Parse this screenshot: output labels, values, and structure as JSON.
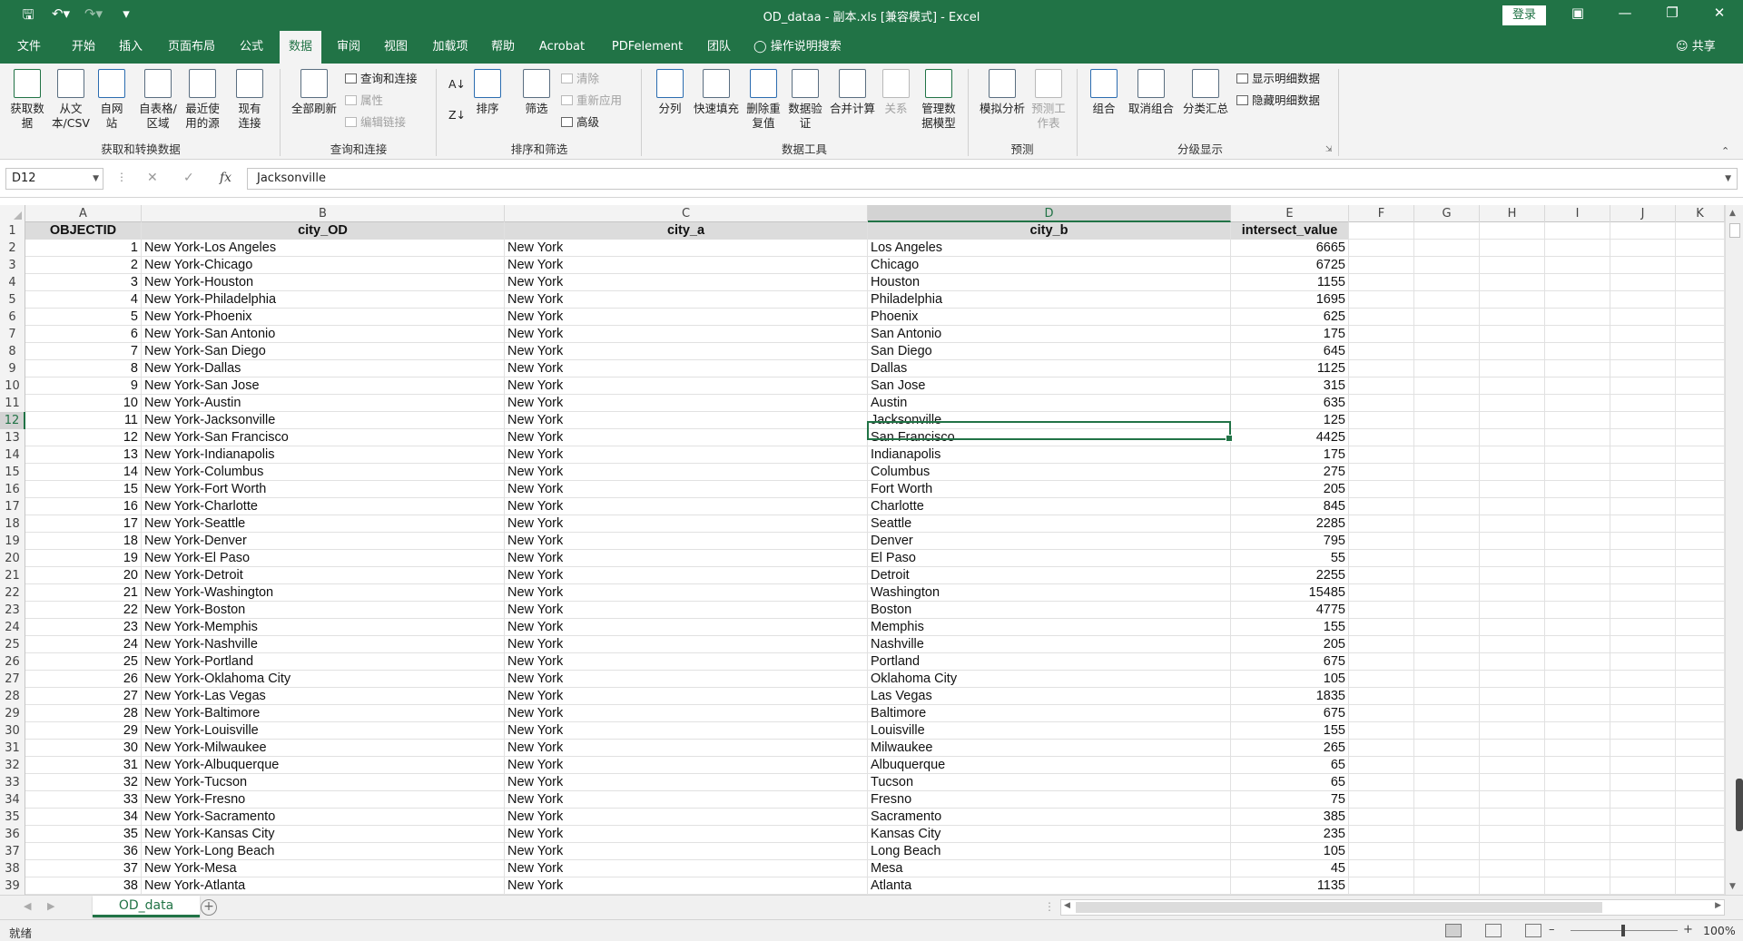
{
  "app": {
    "title": "OD_dataa - 副本.xls  [兼容模式]  -  Excel",
    "login_label": "登录",
    "share_label": "共享",
    "tell_me": "操作说明搜索"
  },
  "menu_tabs": [
    "文件",
    "开始",
    "插入",
    "页面布局",
    "公式",
    "数据",
    "审阅",
    "视图",
    "加载项",
    "帮助",
    "Acrobat",
    "PDFelement",
    "团队"
  ],
  "ribbon": {
    "get_transform": {
      "label": "获取和转换数据",
      "buttons": [
        "获取数据",
        "从文本/CSV",
        "自网站",
        "自表格/区域",
        "最近使用的源",
        "现有连接"
      ]
    },
    "queries": {
      "label": "查询和连接",
      "refresh_all": "全部刷新",
      "items": [
        "查询和连接",
        "属性",
        "编辑链接"
      ]
    },
    "sort_filter": {
      "label": "排序和筛选",
      "sort": "排序",
      "filter": "筛选",
      "items": [
        "清除",
        "重新应用",
        "高级"
      ]
    },
    "data_tools": {
      "label": "数据工具",
      "buttons": [
        "分列",
        "快速填充",
        "删除重复值",
        "数据验证",
        "合并计算",
        "关系",
        "管理数据模型"
      ]
    },
    "forecast": {
      "label": "预测",
      "buttons": [
        "模拟分析",
        "预测工作表"
      ]
    },
    "outline": {
      "label": "分级显示",
      "buttons": [
        "组合",
        "取消组合",
        "分类汇总"
      ],
      "items": [
        "显示明细数据",
        "隐藏明细数据"
      ]
    }
  },
  "formula_bar": {
    "name_box": "D12",
    "content": "Jacksonville"
  },
  "columns": [
    "A",
    "B",
    "C",
    "D",
    "E",
    "F",
    "G",
    "H",
    "I",
    "J",
    "K"
  ],
  "headers": [
    "OBJECTID",
    "city_OD",
    "city_a",
    "city_b",
    "intersect_value"
  ],
  "rows": [
    [
      "1",
      "New York-Los Angeles",
      "New York",
      "Los Angeles",
      "6665"
    ],
    [
      "2",
      "New York-Chicago",
      "New York",
      "Chicago",
      "6725"
    ],
    [
      "3",
      "New York-Houston",
      "New York",
      "Houston",
      "1155"
    ],
    [
      "4",
      "New York-Philadelphia",
      "New York",
      "Philadelphia",
      "1695"
    ],
    [
      "5",
      "New York-Phoenix",
      "New York",
      "Phoenix",
      "625"
    ],
    [
      "6",
      "New York-San Antonio",
      "New York",
      "San Antonio",
      "175"
    ],
    [
      "7",
      "New York-San Diego",
      "New York",
      "San Diego",
      "645"
    ],
    [
      "8",
      "New York-Dallas",
      "New York",
      "Dallas",
      "1125"
    ],
    [
      "9",
      "New York-San Jose",
      "New York",
      "San Jose",
      "315"
    ],
    [
      "10",
      "New York-Austin",
      "New York",
      "Austin",
      "635"
    ],
    [
      "11",
      "New York-Jacksonville",
      "New York",
      "Jacksonville",
      "125"
    ],
    [
      "12",
      "New York-San Francisco",
      "New York",
      "San Francisco",
      "4425"
    ],
    [
      "13",
      "New York-Indianapolis",
      "New York",
      "Indianapolis",
      "175"
    ],
    [
      "14",
      "New York-Columbus",
      "New York",
      "Columbus",
      "275"
    ],
    [
      "15",
      "New York-Fort Worth",
      "New York",
      "Fort Worth",
      "205"
    ],
    [
      "16",
      "New York-Charlotte",
      "New York",
      "Charlotte",
      "845"
    ],
    [
      "17",
      "New York-Seattle",
      "New York",
      "Seattle",
      "2285"
    ],
    [
      "18",
      "New York-Denver",
      "New York",
      "Denver",
      "795"
    ],
    [
      "19",
      "New York-El Paso",
      "New York",
      "El Paso",
      "55"
    ],
    [
      "20",
      "New York-Detroit",
      "New York",
      "Detroit",
      "2255"
    ],
    [
      "21",
      "New York-Washington",
      "New York",
      "Washington",
      "15485"
    ],
    [
      "22",
      "New York-Boston",
      "New York",
      "Boston",
      "4775"
    ],
    [
      "23",
      "New York-Memphis",
      "New York",
      "Memphis",
      "155"
    ],
    [
      "24",
      "New York-Nashville",
      "New York",
      "Nashville",
      "205"
    ],
    [
      "25",
      "New York-Portland",
      "New York",
      "Portland",
      "675"
    ],
    [
      "26",
      "New York-Oklahoma City",
      "New York",
      "Oklahoma City",
      "105"
    ],
    [
      "27",
      "New York-Las Vegas",
      "New York",
      "Las Vegas",
      "1835"
    ],
    [
      "28",
      "New York-Baltimore",
      "New York",
      "Baltimore",
      "675"
    ],
    [
      "29",
      "New York-Louisville",
      "New York",
      "Louisville",
      "155"
    ],
    [
      "30",
      "New York-Milwaukee",
      "New York",
      "Milwaukee",
      "265"
    ],
    [
      "31",
      "New York-Albuquerque",
      "New York",
      "Albuquerque",
      "65"
    ],
    [
      "32",
      "New York-Tucson",
      "New York",
      "Tucson",
      "65"
    ],
    [
      "33",
      "New York-Fresno",
      "New York",
      "Fresno",
      "75"
    ],
    [
      "34",
      "New York-Sacramento",
      "New York",
      "Sacramento",
      "385"
    ],
    [
      "35",
      "New York-Kansas City",
      "New York",
      "Kansas City",
      "235"
    ],
    [
      "36",
      "New York-Long Beach",
      "New York",
      "Long Beach",
      "105"
    ],
    [
      "37",
      "New York-Mesa",
      "New York",
      "Mesa",
      "45"
    ],
    [
      "38",
      "New York-Atlanta",
      "New York",
      "Atlanta",
      "1135"
    ]
  ],
  "selected": {
    "row": 12,
    "col": "D"
  },
  "sheet_tab": "OD_data",
  "status": {
    "ready": "就绪",
    "zoom": "100%"
  },
  "colors": {
    "accent": "#217346",
    "header_fill": "#dcdcdc"
  }
}
